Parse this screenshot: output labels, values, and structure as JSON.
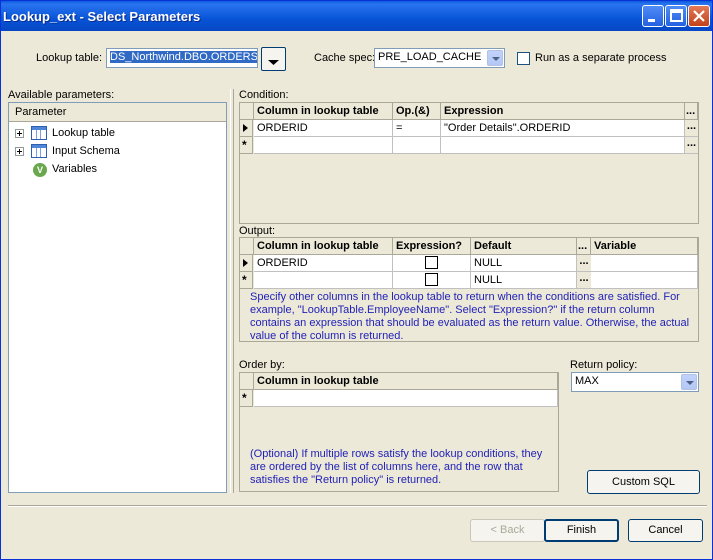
{
  "window": {
    "title": "Lookup_ext - Select Parameters"
  },
  "top": {
    "lookup_table_label": "Lookup table:",
    "lookup_table_value": "DS_Northwind.DBO.ORDERS",
    "cache_spec_label": "Cache spec:",
    "cache_spec_value": "PRE_LOAD_CACHE",
    "separate_process_label": "Run as a separate process"
  },
  "left": {
    "available_label": "Available parameters:",
    "tree_header": "Parameter",
    "tree_items": [
      "Lookup table",
      "Input Schema",
      "Variables"
    ]
  },
  "condition": {
    "label": "Condition:",
    "columns": [
      "Column in lookup table",
      "Op.(&)",
      "Expression"
    ],
    "rows": [
      {
        "column": "ORDERID",
        "op": "=",
        "expression": "\"Order Details\".ORDERID"
      }
    ]
  },
  "output": {
    "label": "Output:",
    "columns": [
      "Column in lookup table",
      "Expression?",
      "Default",
      "Variable"
    ],
    "rows": [
      {
        "column": "ORDERID",
        "default": "NULL"
      },
      {
        "column": "",
        "default": "NULL"
      }
    ],
    "note": "Specify other columns in the lookup table to return when the conditions are satisfied. For example, \"LookupTable.EmployeeName\".  Select \"Expression?\" if the return column contains an expression that should be evaluated as the return value.  Otherwise, the actual value of the column is returned."
  },
  "order_by": {
    "label": "Order by:",
    "columns": [
      "Column in lookup table"
    ],
    "note": "(Optional) If multiple rows satisfy the lookup conditions, they are ordered by the list of columns here, and the row that satisfies the \"Return policy\" is returned."
  },
  "return_policy": {
    "label": "Return policy:",
    "value": "MAX"
  },
  "buttons": {
    "ellipsis": "...",
    "custom_sql": "Custom SQL",
    "back": "< Back",
    "finish": "Finish",
    "cancel": "Cancel"
  },
  "colors": {
    "titlebar": "#0754d7",
    "note_text": "#1f1fb8",
    "face": "#ece9d8"
  }
}
